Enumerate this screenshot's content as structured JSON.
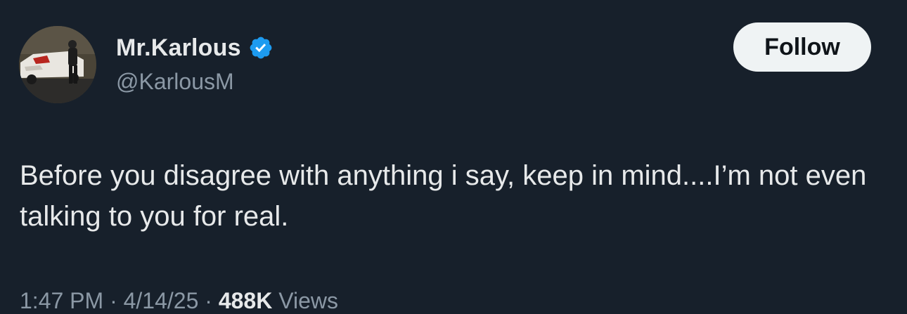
{
  "user": {
    "display_name": "Mr.Karlous",
    "handle": "@KarlousM",
    "verified": true,
    "avatar_description": "photo of person standing next to white car"
  },
  "follow_button": {
    "label": "Follow"
  },
  "tweet": {
    "text": "Before you disagree with anything i say, keep in mind....I’m not even talking to you for real."
  },
  "meta": {
    "time": "1:47 PM",
    "separator": "·",
    "date": "4/14/25",
    "views_count": "488K",
    "views_label": "Views"
  },
  "colors": {
    "background": "#17202b",
    "text_primary": "#e7e9ea",
    "text_secondary": "#8b98a5",
    "verified_blue": "#1d9bf0",
    "button_bg": "#eff3f4"
  }
}
